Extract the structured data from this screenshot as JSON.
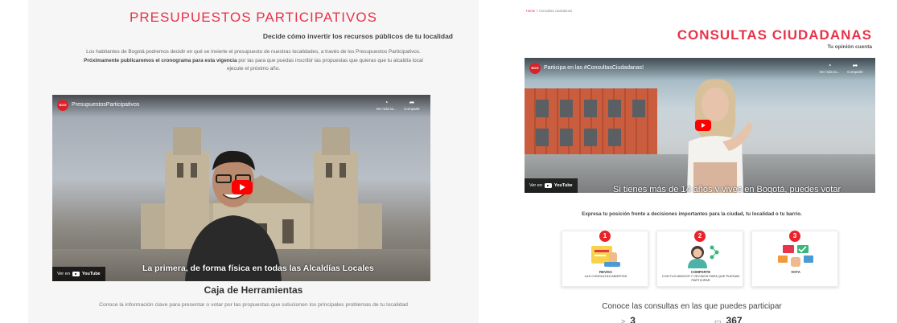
{
  "colors": {
    "accent": "#e8334a",
    "youtube_red": "#ff0000",
    "card_badge": "#e8232a"
  },
  "left_page": {
    "title": "PRESUPUESTOS PARTICIPATIVOS",
    "subtitle": "Decide cómo invertir los recursos públicos de tu localidad",
    "paragraph": {
      "intro": "Los habitantes de Bogotá podremos decidir en qué se invierte el presupuesto de nuestras localidades, a través de los Presupuestos Participativos. ",
      "highlight": "Próximamente publicaremos el cronograma para esta vigencia",
      "outro": " por las para que puedas inscribir las propuestas que quieras que tu alcaldía local ejecute el próximo año."
    },
    "video": {
      "channel": "PresupuestosParticipativos",
      "avatar_text": "BOG",
      "watch_later": "Ver más ta...",
      "share": "Compartir",
      "caption": "La primera, de forma física en todas las Alcaldías Locales",
      "watch_on": "Ver en",
      "youtube": "YouTube",
      "icons": {
        "clock": "clock-icon",
        "share": "share-icon",
        "play": "play-icon"
      }
    },
    "section_title": "Caja de Herramientas",
    "section_text": "Conoce la información clave para presentar o votar por las propuestas que solucionen los principales problemas de tu localidad"
  },
  "right_page": {
    "breadcrumb": {
      "home": "Home",
      "separator": ">",
      "current": "Consultas ciudadanas"
    },
    "title": "CONSULTAS CIUDADANAS",
    "subtitle": "Tu opinión cuenta",
    "video": {
      "channel": "Participa en las #ConsultasCiudadanas!",
      "avatar_text": "BOG",
      "watch_later": "Ver más ta...",
      "share": "Compartir",
      "caption": "Si tienes más de 14 años y vives en Bogotá, puedes votar",
      "watch_on": "Ver en",
      "youtube": "YouTube"
    },
    "lead": "Expresa tu posición frente a decisiones importantes para la ciudad, tu localidad o tu barrio.",
    "cards": [
      {
        "number": "1",
        "title": "REVISA",
        "text": "LAS CONSULTAS ABIERTAS",
        "icon": "document-hand-icon"
      },
      {
        "number": "2",
        "title": "COMPARTE",
        "text": "CON TUS AMIGOS Y VECINOS PARA QUE PUEDAN PARTICIPAR",
        "icon": "woman-share-icon"
      },
      {
        "number": "3",
        "title": "VOTA",
        "text": "",
        "icon": "vote-hands-icon"
      }
    ],
    "conoce": "Conoce las consultas en las que puedes participar",
    "stats": [
      {
        "icon": "arrow-icon",
        "glyph": ">",
        "value": "3"
      },
      {
        "icon": "calendar-icon",
        "glyph": "▭",
        "value": "367"
      }
    ]
  }
}
